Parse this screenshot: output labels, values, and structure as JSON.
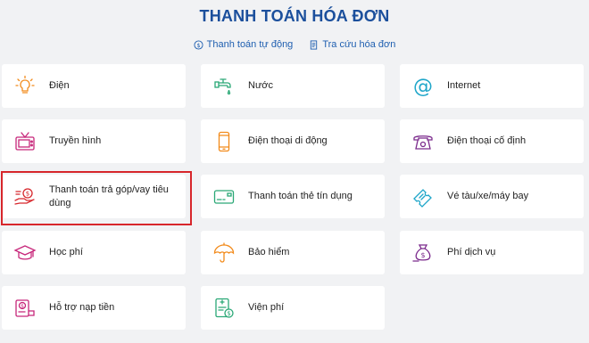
{
  "page": {
    "title": "THANH TOÁN HÓA ĐƠN",
    "links": [
      {
        "label": "Thanh toán tự động",
        "icon": "dollar-circle-icon"
      },
      {
        "label": "Tra cứu hóa đơn",
        "icon": "receipt-icon"
      }
    ]
  },
  "services": [
    {
      "label": "Điện",
      "icon": "bulb-icon"
    },
    {
      "label": "Nước",
      "icon": "water-tap-icon"
    },
    {
      "label": "Internet",
      "icon": "at-sign-icon"
    },
    {
      "label": "Truyền hình",
      "icon": "tv-icon"
    },
    {
      "label": "Điện thoại di động",
      "icon": "mobile-phone-icon"
    },
    {
      "label": "Điện thoại cố định",
      "icon": "landline-phone-icon"
    },
    {
      "label": "Thanh toán trả góp/vay tiêu dùng",
      "icon": "loan-hand-icon"
    },
    {
      "label": "Thanh toán thẻ tín dụng",
      "icon": "credit-card-icon"
    },
    {
      "label": "Vé tàu/xe/máy bay",
      "icon": "ticket-icon"
    },
    {
      "label": "Học phí",
      "icon": "graduation-cap-icon"
    },
    {
      "label": "Bảo hiểm",
      "icon": "umbrella-icon"
    },
    {
      "label": "Phí dịch vụ",
      "icon": "money-bag-icon"
    },
    {
      "label": "Hỗ trợ nạp tiền",
      "icon": "wallet-icon"
    },
    {
      "label": "Viện phí",
      "icon": "hospital-bill-icon"
    }
  ],
  "colors": {
    "title": "#1b4f9c",
    "highlight": "#d7262b",
    "orange": "#f28a1a",
    "magenta": "#c7267a",
    "green": "#2aa876",
    "teal": "#1fa6c9",
    "purple": "#7b2a8c"
  }
}
